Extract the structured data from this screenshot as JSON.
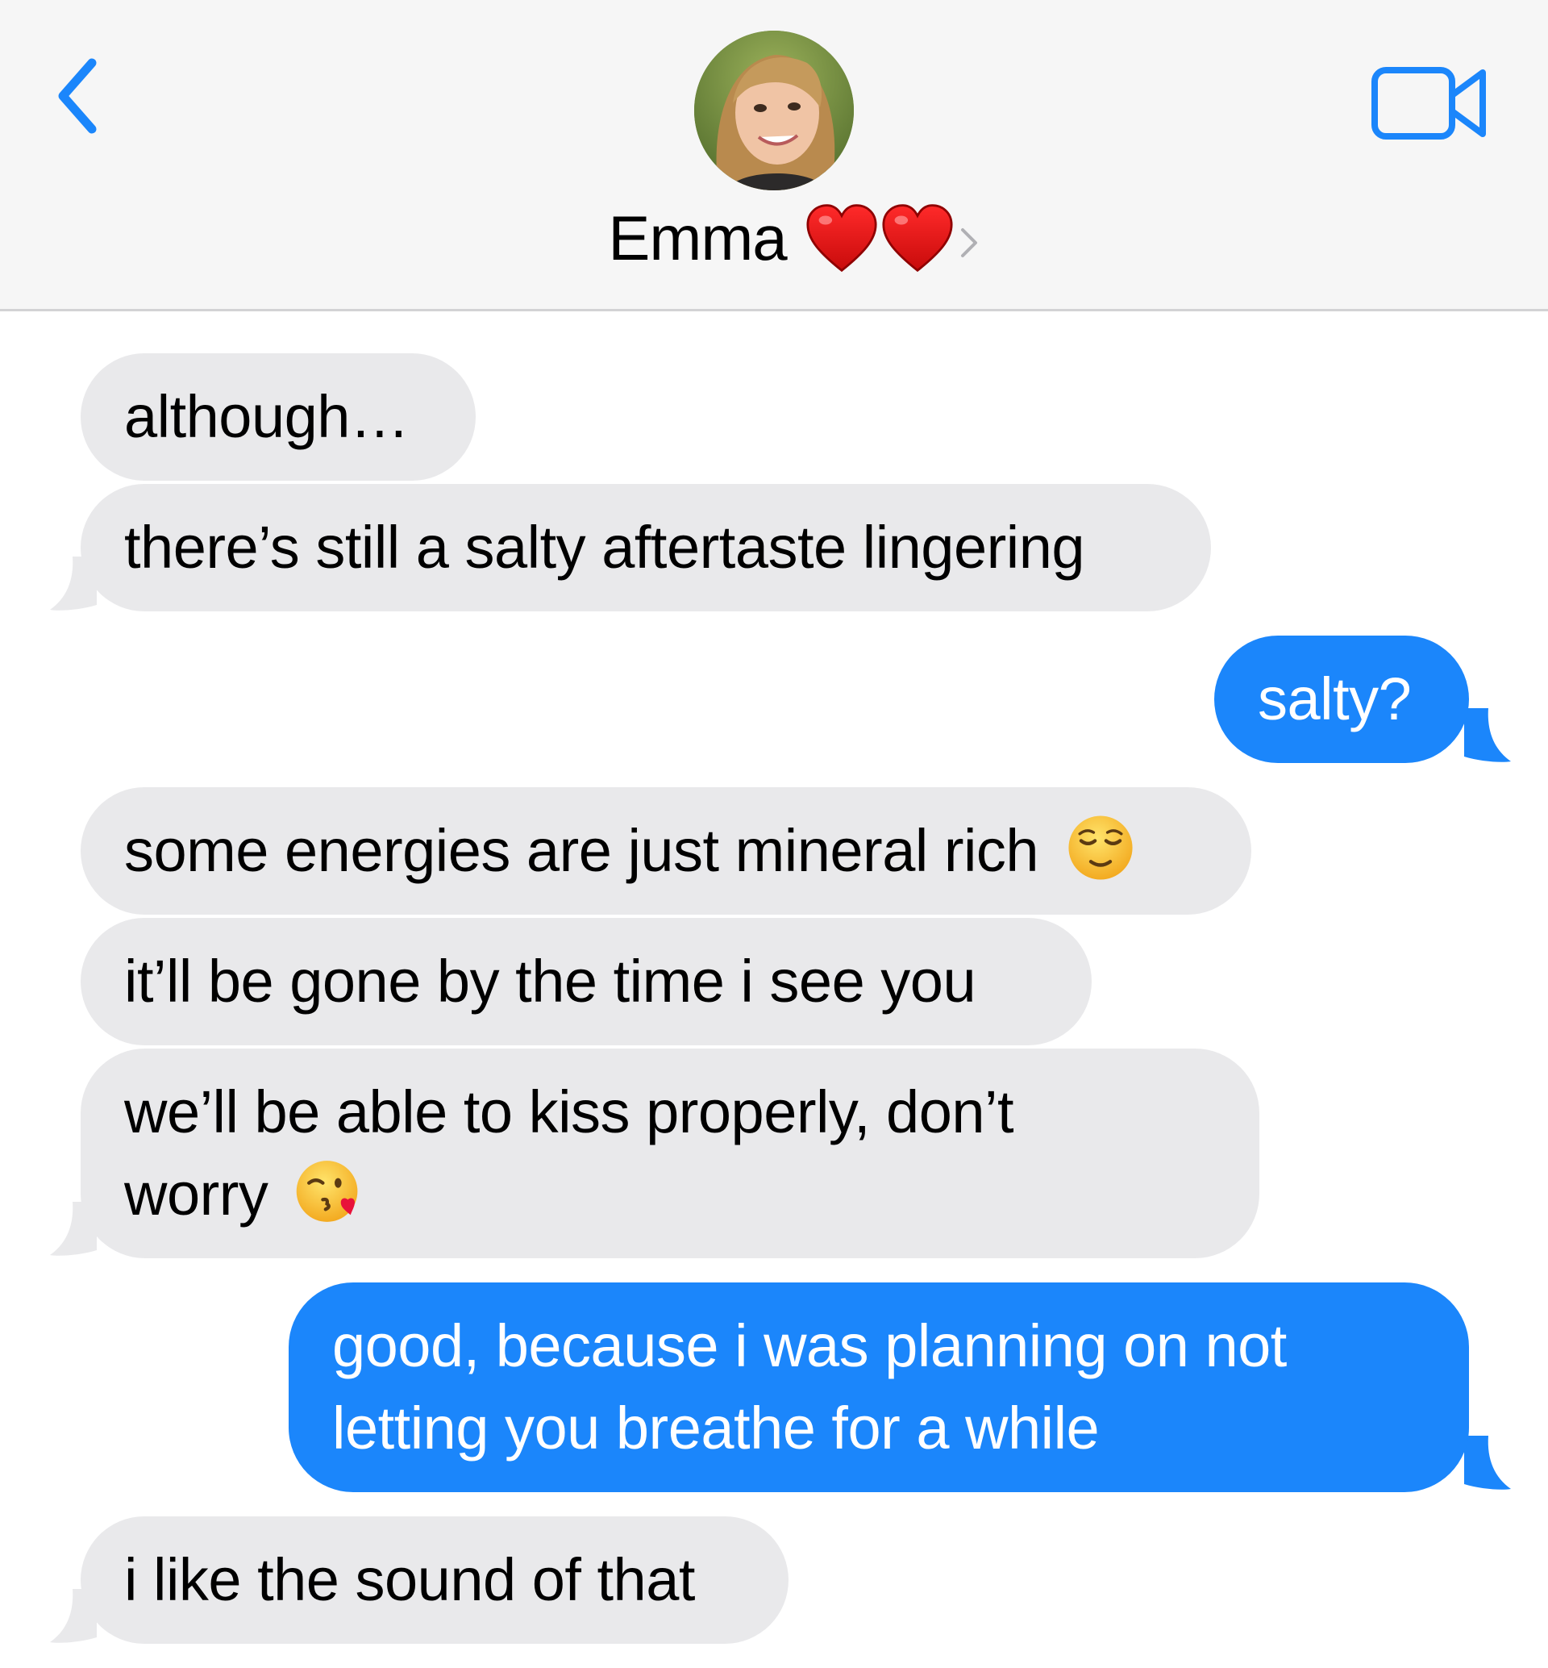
{
  "header": {
    "contact_name": "Emma",
    "back_icon": "chevron-left-icon",
    "video_icon": "video-camera-icon",
    "accent": "#1b86fb"
  },
  "messages": [
    {
      "direction": "in",
      "text": "although…"
    },
    {
      "direction": "in",
      "text": "there’s still a salty aftertaste lingering"
    },
    {
      "direction": "out",
      "text": "salty?"
    },
    {
      "direction": "in",
      "text": "some energies are just mineral rich",
      "emoji": "relieved-face"
    },
    {
      "direction": "in",
      "text": "it’ll be gone by the time i see you"
    },
    {
      "direction": "in",
      "line1": "we’ll be able to kiss properly, don’t",
      "line2": "worry",
      "emoji": "face-blowing-kiss"
    },
    {
      "direction": "out",
      "line1": "good, because i was planning on not",
      "line2": "letting you breathe for a while"
    },
    {
      "direction": "in",
      "text": "i like the sound of that"
    }
  ],
  "colors": {
    "incoming_bubble": "#e9e9eb",
    "outgoing_bubble": "#1b86fb",
    "header_bg": "#f6f6f6"
  }
}
